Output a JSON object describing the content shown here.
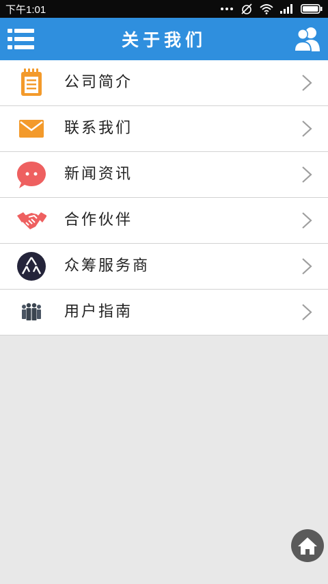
{
  "status_bar": {
    "time": "下午1:01"
  },
  "header": {
    "title": "关于我们"
  },
  "menu": [
    {
      "label": "公司简介"
    },
    {
      "label": "联系我们"
    },
    {
      "label": "新闻资讯"
    },
    {
      "label": "合作伙伴"
    },
    {
      "label": "众筹服务商"
    },
    {
      "label": "用户指南"
    }
  ],
  "icons": {
    "company_intro": "notepad-icon",
    "contact": "envelope-icon",
    "news": "chat-bubble-icon",
    "partners": "handshake-icon",
    "crowdfunding": "crowd-logo-icon",
    "guide": "people-group-icon"
  },
  "colors": {
    "header": "#2f8fde",
    "status_bar": "#0b0b0b",
    "orange": "#f39a2b",
    "red": "#ee6060",
    "dark": "#24243a",
    "background": "#e8e8e8"
  }
}
